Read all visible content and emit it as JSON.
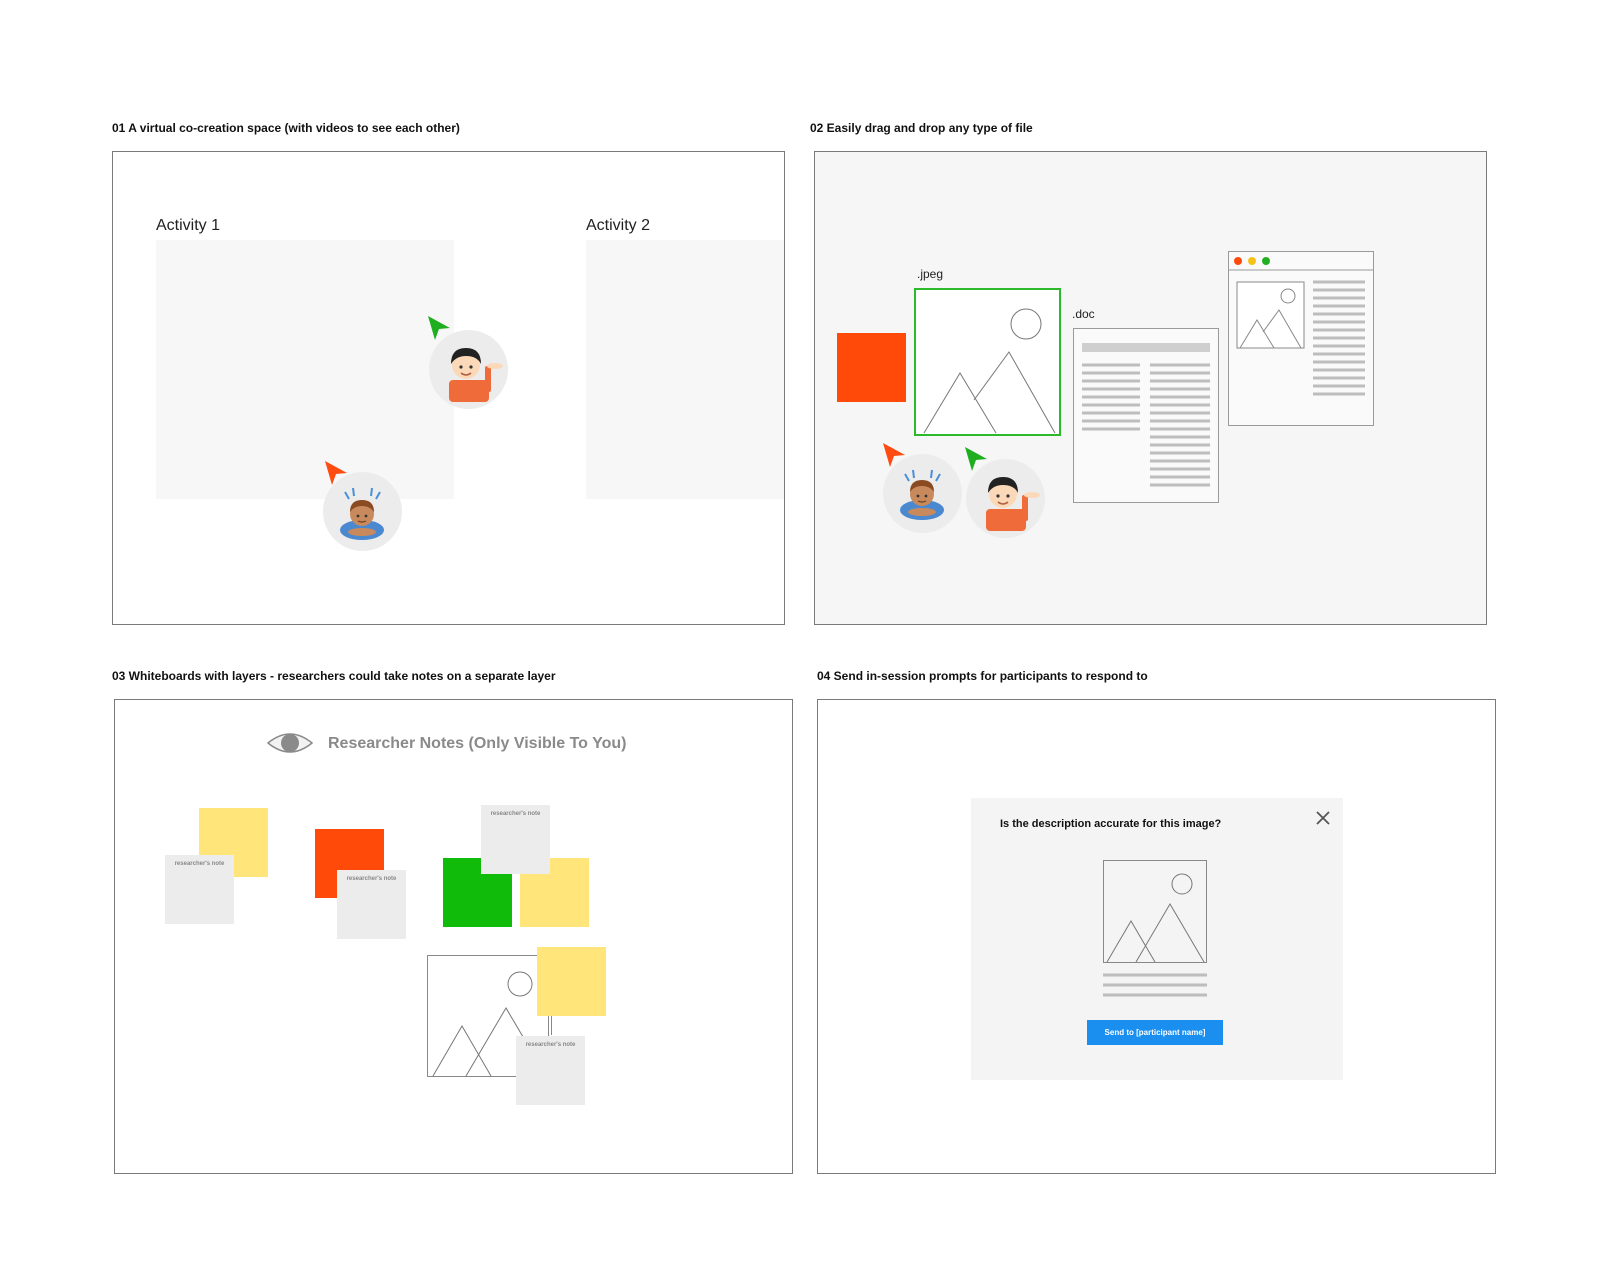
{
  "captions": {
    "p1": "01 A virtual co-creation space (with videos to see each other)",
    "p2": "02 Easily drag and drop any type of file",
    "p3": "03 Whiteboards with layers - researchers could take notes on a separate layer",
    "p4": "04 Send in-session prompts for participants to respond to"
  },
  "panel1": {
    "activity1": "Activity 1",
    "activity2": "Activity 2"
  },
  "panel2": {
    "jpeg_label": ".jpeg",
    "doc_label": ".doc"
  },
  "panel3": {
    "layer_title": "Researcher Notes (Only Visible To You)",
    "note_label": "researcher's note"
  },
  "panel4": {
    "question": "Is the description accurate for this image?",
    "send_button": "Send to [participant name]"
  },
  "colors": {
    "green_cursor": "#1fae1f",
    "orange_cursor": "#ff4a12",
    "sticky_yellow": "#ffe57a",
    "sticky_orange": "#ff4a0a",
    "sticky_green": "#11bb0a",
    "button_blue": "#1a8ff0"
  }
}
